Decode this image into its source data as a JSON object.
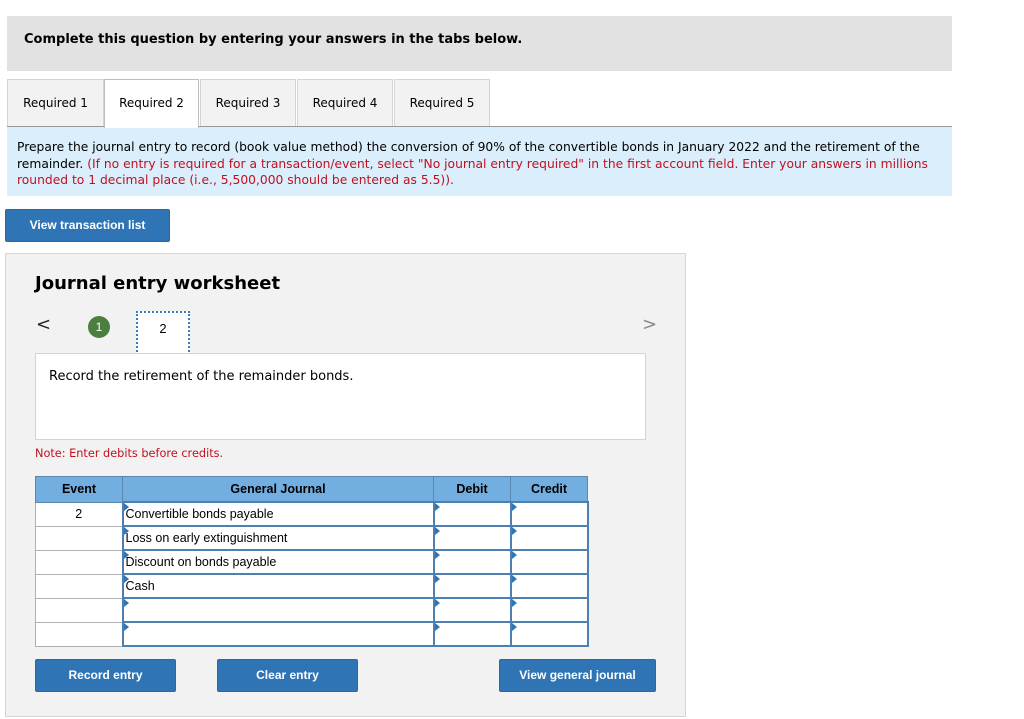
{
  "header": {
    "instruction": "Complete this question by entering your answers in the tabs below."
  },
  "tabs": [
    {
      "label": "Required 1",
      "active": false
    },
    {
      "label": "Required 2",
      "active": true
    },
    {
      "label": "Required 3",
      "active": false
    },
    {
      "label": "Required 4",
      "active": false
    },
    {
      "label": "Required 5",
      "active": false
    }
  ],
  "instructions": {
    "main": "Prepare the journal entry to record (book value method) the conversion of 90% of the convertible bonds in January 2022 and the retirement of the remainder.",
    "red": "(If no entry is required for a transaction/event, select \"No journal entry required\" in the first account field. Enter your answers in millions rounded to 1 decimal place (i.e., 5,500,000 should be entered as 5.5))."
  },
  "buttons": {
    "view_transaction_list": "View transaction list",
    "record_entry": "Record entry",
    "clear_entry": "Clear entry",
    "view_general_journal": "View general journal"
  },
  "worksheet": {
    "title": "Journal entry worksheet",
    "prev_icon": "<",
    "next_icon": ">",
    "steps": [
      {
        "label": "1",
        "status": "completed"
      },
      {
        "label": "2",
        "status": "current"
      }
    ],
    "description": "Record the retirement of the remainder bonds.",
    "note": "Note: Enter debits before credits."
  },
  "journal": {
    "columns": [
      "Event",
      "General Journal",
      "Debit",
      "Credit"
    ],
    "rows": [
      {
        "event": "2",
        "account": "Convertible bonds payable",
        "debit": "",
        "credit": ""
      },
      {
        "event": "",
        "account": "Loss on early extinguishment",
        "debit": "",
        "credit": ""
      },
      {
        "event": "",
        "account": "Discount on bonds payable",
        "debit": "",
        "credit": ""
      },
      {
        "event": "",
        "account": "Cash",
        "debit": "",
        "credit": ""
      },
      {
        "event": "",
        "account": "",
        "debit": "",
        "credit": ""
      },
      {
        "event": "",
        "account": "",
        "debit": "",
        "credit": ""
      }
    ]
  },
  "colors": {
    "primary_button": "#2f75b5",
    "table_header": "#73aee0",
    "instruction_bg": "#dbeefb",
    "warning_red": "#c0111f",
    "step_complete": "#4b7f3f"
  }
}
